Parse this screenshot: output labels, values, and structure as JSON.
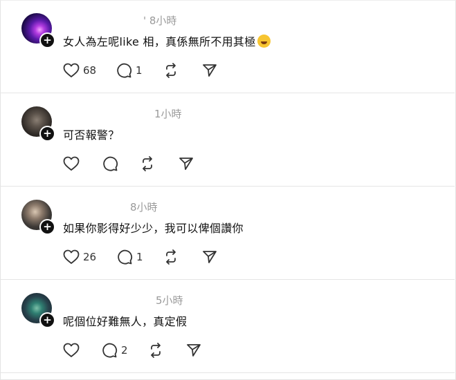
{
  "posts": [
    {
      "time": "' 8小時",
      "text": "女人為左呢like 相，真係無所不用其極",
      "emoji": "rolling-on-floor-laughing-emoji",
      "likes": "68",
      "replies": "1",
      "reposts": "",
      "shares": ""
    },
    {
      "time": "1小時",
      "text": "可否報警？",
      "likes": "",
      "replies": "",
      "reposts": "",
      "shares": ""
    },
    {
      "time": "8小時",
      "text": "如果你影得好少少，我可以俾個讚你",
      "likes": "26",
      "replies": "1",
      "reposts": "",
      "shares": ""
    },
    {
      "time": "5小時",
      "text": "呢個位好難無人，真定假",
      "likes": "",
      "replies": "2",
      "reposts": "",
      "shares": ""
    }
  ],
  "icons": {
    "avatar_add": "plus-icon",
    "like": "heart-icon",
    "reply": "comment-bubble-icon",
    "repost": "repost-arrows-icon",
    "share": "send-icon"
  }
}
